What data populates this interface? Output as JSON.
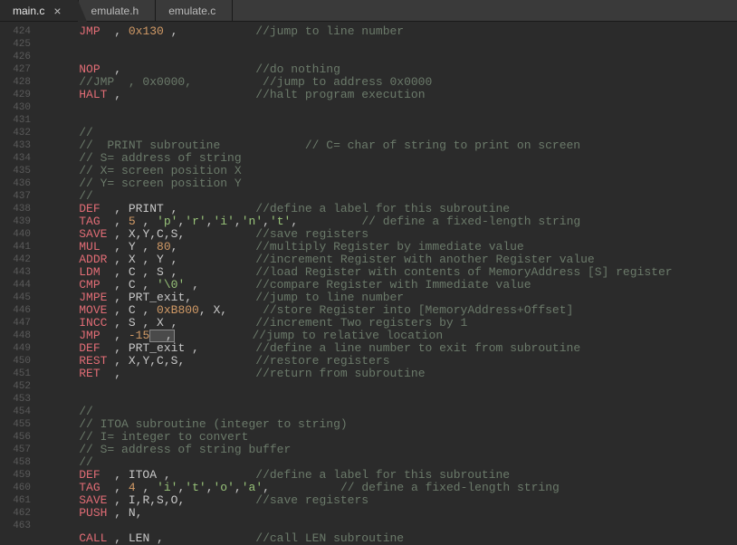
{
  "tabs": [
    {
      "label": "main.c",
      "active": true,
      "close": "×"
    },
    {
      "label": "emulate.h",
      "active": false,
      "close": ""
    },
    {
      "label": "emulate.c",
      "active": false,
      "close": ""
    }
  ],
  "gutter": [
    "424",
    "425",
    "426",
    "427",
    "428",
    "429",
    "430",
    "431",
    "432",
    "433",
    "434",
    "435",
    "436",
    "437",
    "438",
    "439",
    "440",
    "441",
    "442",
    "443",
    "444",
    "445",
    "446",
    "447",
    "448",
    "449",
    "450",
    "451",
    "452",
    "453",
    "454",
    "455",
    "456",
    "457",
    "458",
    "459",
    "460",
    "461",
    "462",
    "463"
  ],
  "lines": [
    {
      "parts": [
        {
          "t": "    "
        },
        {
          "t": "JMP",
          "c": "kw"
        },
        {
          "t": "  , "
        },
        {
          "t": "0x130",
          "c": "num"
        },
        {
          "t": " ,           "
        },
        {
          "t": "//jump to line number",
          "c": "cmt"
        }
      ]
    },
    {
      "parts": []
    },
    {
      "parts": []
    },
    {
      "parts": [
        {
          "t": "    "
        },
        {
          "t": "NOP",
          "c": "kw"
        },
        {
          "t": "  ,                   "
        },
        {
          "t": "//do nothing",
          "c": "cmt"
        }
      ]
    },
    {
      "parts": [
        {
          "t": "    "
        },
        {
          "t": "//JMP  , 0x0000,          //jump to address 0x0000",
          "c": "cmt"
        }
      ]
    },
    {
      "parts": [
        {
          "t": "    "
        },
        {
          "t": "HALT",
          "c": "kw"
        },
        {
          "t": " ,                   "
        },
        {
          "t": "//halt program execution",
          "c": "cmt"
        }
      ]
    },
    {
      "parts": []
    },
    {
      "parts": []
    },
    {
      "parts": [
        {
          "t": "    "
        },
        {
          "t": "//",
          "c": "cmt"
        }
      ]
    },
    {
      "parts": [
        {
          "t": "    "
        },
        {
          "t": "//  PRINT subroutine            // C= char of string to print on screen",
          "c": "cmt"
        }
      ]
    },
    {
      "parts": [
        {
          "t": "    "
        },
        {
          "t": "// S= address of string",
          "c": "cmt"
        }
      ]
    },
    {
      "parts": [
        {
          "t": "    "
        },
        {
          "t": "// X= screen position X",
          "c": "cmt"
        }
      ]
    },
    {
      "parts": [
        {
          "t": "    "
        },
        {
          "t": "// Y= screen position Y",
          "c": "cmt"
        }
      ]
    },
    {
      "parts": [
        {
          "t": "    "
        },
        {
          "t": "//",
          "c": "cmt"
        }
      ]
    },
    {
      "parts": [
        {
          "t": "    "
        },
        {
          "t": "DEF",
          "c": "kw"
        },
        {
          "t": "  , PRINT ,           "
        },
        {
          "t": "//define a label for this subroutine",
          "c": "cmt"
        }
      ]
    },
    {
      "parts": [
        {
          "t": "    "
        },
        {
          "t": "TAG",
          "c": "kw"
        },
        {
          "t": "  , "
        },
        {
          "t": "5",
          "c": "num"
        },
        {
          "t": " , "
        },
        {
          "t": "'p'",
          "c": "str"
        },
        {
          "t": ","
        },
        {
          "t": "'r'",
          "c": "str"
        },
        {
          "t": ","
        },
        {
          "t": "'i'",
          "c": "str"
        },
        {
          "t": ","
        },
        {
          "t": "'n'",
          "c": "str"
        },
        {
          "t": ","
        },
        {
          "t": "'t'",
          "c": "str"
        },
        {
          "t": ",         "
        },
        {
          "t": "// define a fixed-length string",
          "c": "cmt"
        }
      ]
    },
    {
      "parts": [
        {
          "t": "    "
        },
        {
          "t": "SAVE",
          "c": "kw"
        },
        {
          "t": " , X,Y,C,S,          "
        },
        {
          "t": "//save registers",
          "c": "cmt"
        }
      ]
    },
    {
      "parts": [
        {
          "t": "    "
        },
        {
          "t": "MUL",
          "c": "kw"
        },
        {
          "t": "  , Y , "
        },
        {
          "t": "80",
          "c": "num"
        },
        {
          "t": ",           "
        },
        {
          "t": "//multiply Register by immediate value",
          "c": "cmt"
        }
      ]
    },
    {
      "parts": [
        {
          "t": "    "
        },
        {
          "t": "ADDR",
          "c": "kw"
        },
        {
          "t": " , X , Y ,           "
        },
        {
          "t": "//increment Register with another Register value",
          "c": "cmt"
        }
      ]
    },
    {
      "parts": [
        {
          "t": "    "
        },
        {
          "t": "LDM",
          "c": "kw"
        },
        {
          "t": "  , C , S ,           "
        },
        {
          "t": "//load Register with contents of MemoryAddress [S] register",
          "c": "cmt"
        }
      ]
    },
    {
      "parts": [
        {
          "t": "    "
        },
        {
          "t": "CMP",
          "c": "kw"
        },
        {
          "t": "  , C , "
        },
        {
          "t": "'\\0'",
          "c": "str"
        },
        {
          "t": " ,        "
        },
        {
          "t": "//compare Register with Immediate value",
          "c": "cmt"
        }
      ]
    },
    {
      "parts": [
        {
          "t": "    "
        },
        {
          "t": "JMPE",
          "c": "kw"
        },
        {
          "t": " , PRT_exit,         "
        },
        {
          "t": "//jump to line number",
          "c": "cmt"
        }
      ]
    },
    {
      "parts": [
        {
          "t": "    "
        },
        {
          "t": "MOVE",
          "c": "kw"
        },
        {
          "t": " , C , "
        },
        {
          "t": "0xB800",
          "c": "num"
        },
        {
          "t": ", X,     "
        },
        {
          "t": "//store Register into [MemoryAddress+Offset]",
          "c": "cmt"
        }
      ]
    },
    {
      "parts": [
        {
          "t": "    "
        },
        {
          "t": "INCC",
          "c": "kw"
        },
        {
          "t": " , S , X ,           "
        },
        {
          "t": "//increment Two registers by 1",
          "c": "cmt"
        }
      ]
    },
    {
      "parts": [
        {
          "t": "    "
        },
        {
          "t": "JMP",
          "c": "kw"
        },
        {
          "t": "  , "
        },
        {
          "t": "-15",
          "c": "num"
        },
        {
          "t": "  ,",
          "sel": true
        },
        {
          "t": "           "
        },
        {
          "t": "//jump to relative location",
          "c": "cmt"
        }
      ]
    },
    {
      "parts": [
        {
          "t": "    "
        },
        {
          "t": "DEF",
          "c": "kw"
        },
        {
          "t": "  , PRT_exit ,        "
        },
        {
          "t": "//define a line number to exit from subroutine",
          "c": "cmt"
        }
      ]
    },
    {
      "parts": [
        {
          "t": "    "
        },
        {
          "t": "REST",
          "c": "kw"
        },
        {
          "t": " , X,Y,C,S,          "
        },
        {
          "t": "//restore registers",
          "c": "cmt"
        }
      ]
    },
    {
      "parts": [
        {
          "t": "    "
        },
        {
          "t": "RET",
          "c": "kw"
        },
        {
          "t": "  ,                   "
        },
        {
          "t": "//return from subroutine",
          "c": "cmt"
        }
      ]
    },
    {
      "parts": []
    },
    {
      "parts": []
    },
    {
      "parts": [
        {
          "t": "    "
        },
        {
          "t": "//",
          "c": "cmt"
        }
      ]
    },
    {
      "parts": [
        {
          "t": "    "
        },
        {
          "t": "// ITOA subroutine (integer to string)",
          "c": "cmt"
        }
      ]
    },
    {
      "parts": [
        {
          "t": "    "
        },
        {
          "t": "// I= integer to convert",
          "c": "cmt"
        }
      ]
    },
    {
      "parts": [
        {
          "t": "    "
        },
        {
          "t": "// S= address of string buffer",
          "c": "cmt"
        }
      ]
    },
    {
      "parts": [
        {
          "t": "    "
        },
        {
          "t": "//",
          "c": "cmt"
        }
      ]
    },
    {
      "parts": [
        {
          "t": "    "
        },
        {
          "t": "DEF",
          "c": "kw"
        },
        {
          "t": "  , ITOA ,            "
        },
        {
          "t": "//define a label for this subroutine",
          "c": "cmt"
        }
      ]
    },
    {
      "parts": [
        {
          "t": "    "
        },
        {
          "t": "TAG",
          "c": "kw"
        },
        {
          "t": "  , "
        },
        {
          "t": "4",
          "c": "num"
        },
        {
          "t": " , "
        },
        {
          "t": "'i'",
          "c": "str"
        },
        {
          "t": ","
        },
        {
          "t": "'t'",
          "c": "str"
        },
        {
          "t": ","
        },
        {
          "t": "'o'",
          "c": "str"
        },
        {
          "t": ","
        },
        {
          "t": "'a'",
          "c": "str"
        },
        {
          "t": ",          "
        },
        {
          "t": "// define a fixed-length string",
          "c": "cmt"
        }
      ]
    },
    {
      "parts": [
        {
          "t": "    "
        },
        {
          "t": "SAVE",
          "c": "kw"
        },
        {
          "t": " , I,R,S,O,          "
        },
        {
          "t": "//save registers",
          "c": "cmt"
        }
      ]
    },
    {
      "parts": [
        {
          "t": "    "
        },
        {
          "t": "PUSH",
          "c": "kw"
        },
        {
          "t": " , N,"
        }
      ]
    },
    {
      "parts": []
    },
    {
      "parts": [
        {
          "t": "    "
        },
        {
          "t": "CALL",
          "c": "kw"
        },
        {
          "t": " , LEN ,             "
        },
        {
          "t": "//call LEN subroutine",
          "c": "cmt"
        }
      ]
    }
  ]
}
